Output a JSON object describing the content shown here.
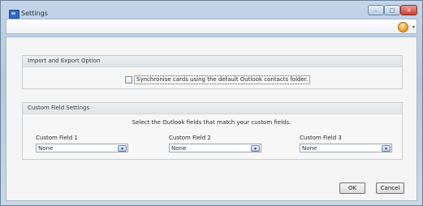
{
  "window": {
    "title": "Settings"
  },
  "title_controls": {
    "minimize": "–",
    "maximize": "□",
    "close": "✕"
  },
  "toolbar": {
    "help_icon": "help-icon",
    "help_glyph": "?",
    "help_caret": "▾"
  },
  "import_export": {
    "heading": "Import and Export Option",
    "sync_label": "Synchronise cards using the default Outlook contacts folder.",
    "sync_checked": false
  },
  "custom_fields": {
    "heading": "Custom Field Settings",
    "instruction": "Select the Outlook fields that match your custom fields.",
    "fields": [
      {
        "label": "Custom Field 1",
        "value": "None"
      },
      {
        "label": "Custom Field 2",
        "value": "None"
      },
      {
        "label": "Custom Field 3",
        "value": "None"
      }
    ]
  },
  "buttons": {
    "ok": "OK",
    "cancel": "Cancel"
  }
}
